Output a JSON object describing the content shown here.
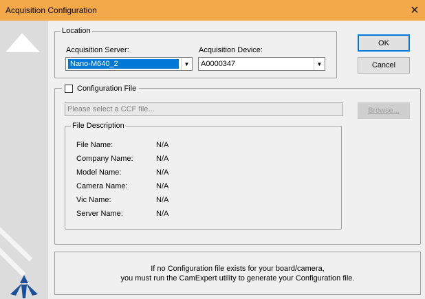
{
  "window": {
    "title": "Acquisition Configuration",
    "close_glyph": "✕"
  },
  "location": {
    "legend": "Location",
    "server_label": "Acquisition Server:",
    "server_value": "Nano-M640_2",
    "device_label": "Acquisition Device:",
    "device_value": "A0000347"
  },
  "buttons": {
    "ok": "OK",
    "cancel": "Cancel",
    "browse": "Browse..."
  },
  "config_file": {
    "checkbox_label": "Configuration File",
    "checked": false,
    "placeholder": "Please select a CCF file..."
  },
  "file_description": {
    "legend": "File Description",
    "rows": [
      {
        "label": "File Name:",
        "value": "N/A"
      },
      {
        "label": "Company Name:",
        "value": "N/A"
      },
      {
        "label": "Model Name:",
        "value": "N/A"
      },
      {
        "label": "Camera Name:",
        "value": "N/A"
      },
      {
        "label": "Vic Name:",
        "value": "N/A"
      },
      {
        "label": "Server Name:",
        "value": "N/A"
      }
    ]
  },
  "info": {
    "line1": "If no Configuration file exists for your board/camera,",
    "line2": "you must run the CamExpert utility to generate your Configuration file."
  },
  "colors": {
    "titlebar": "#f3a94a",
    "selection": "#0078d7",
    "logo": "#1a4f9c"
  },
  "icons": {
    "dropdown": "chevron-down-icon",
    "logo": "teledyne-logo-icon"
  }
}
